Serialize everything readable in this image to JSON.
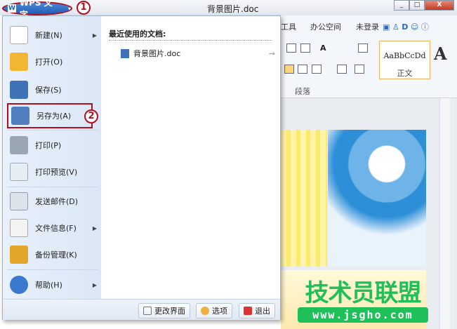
{
  "titlebar": {
    "app_button": "WPS 文字",
    "doc_title": "背景图片.doc",
    "marker1": "1",
    "marker2": "2"
  },
  "ribbon": {
    "tabs": [
      "工具",
      "办公空间",
      "未登录"
    ],
    "style_sample": "AaBbCcDd",
    "style_name": "正文",
    "big_a": "A",
    "group_label": "段落"
  },
  "menu": {
    "items": [
      {
        "label": "新建(N)",
        "icon": "new-doc-icon",
        "submenu": true
      },
      {
        "label": "打开(O)",
        "icon": "open-folder-icon",
        "submenu": false
      },
      {
        "label": "保存(S)",
        "icon": "save-icon",
        "submenu": false
      },
      {
        "label": "另存为(A)",
        "icon": "save-as-icon",
        "submenu": false
      },
      {
        "label": "打印(P)",
        "icon": "printer-icon",
        "submenu": false
      },
      {
        "label": "打印预览(V)",
        "icon": "print-preview-icon",
        "submenu": false
      },
      {
        "label": "发送邮件(D)",
        "icon": "mail-icon",
        "submenu": false
      },
      {
        "label": "文件信息(F)",
        "icon": "file-info-icon",
        "submenu": true
      },
      {
        "label": "备份管理(K)",
        "icon": "backup-icon",
        "submenu": false
      },
      {
        "label": "帮助(H)",
        "icon": "help-icon",
        "submenu": true
      }
    ],
    "recent_title": "最近使用的文档:",
    "recent_docs": [
      "背景图片.doc"
    ],
    "bottom": {
      "change_ui": "更改界面",
      "options": "选项",
      "exit": "退出"
    }
  },
  "watermark": {
    "text": "技术员联盟",
    "url": "www.jsgho.com"
  }
}
